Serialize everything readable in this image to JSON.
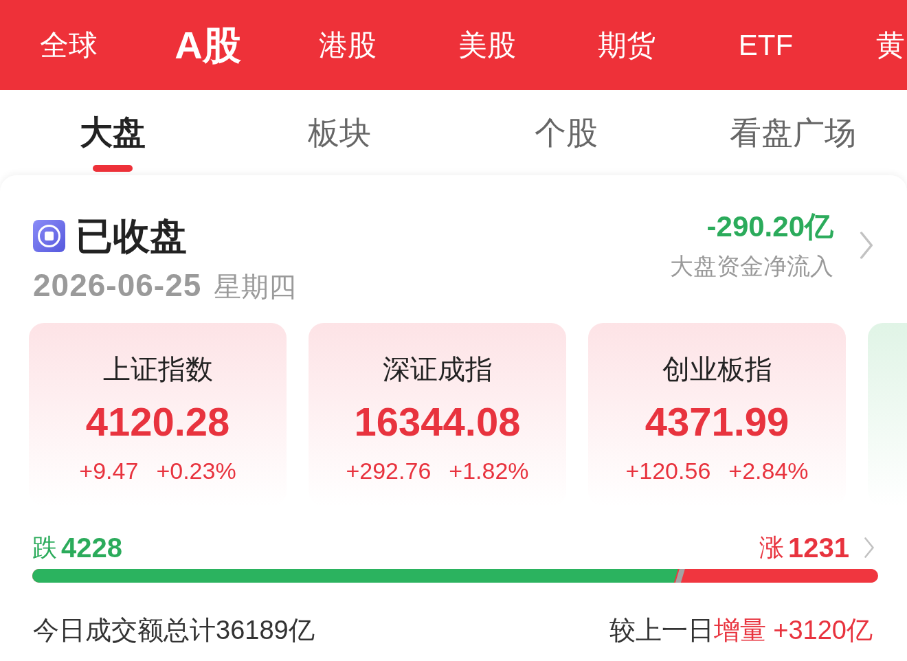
{
  "market_tabs": [
    {
      "label": "全球",
      "selected": false
    },
    {
      "label": "A股",
      "selected": true
    },
    {
      "label": "港股",
      "selected": false
    },
    {
      "label": "美股",
      "selected": false
    },
    {
      "label": "期货",
      "selected": false
    },
    {
      "label": "ETF",
      "selected": false
    },
    {
      "label": "黄",
      "selected": false
    }
  ],
  "section_tabs": [
    {
      "label": "大盘",
      "selected": true
    },
    {
      "label": "板块",
      "selected": false
    },
    {
      "label": "个股",
      "selected": false
    },
    {
      "label": "看盘广场",
      "selected": false
    }
  ],
  "market_status": {
    "status": "已收盘",
    "date": "2026-06-25",
    "weekday": "星期四"
  },
  "net_inflow": {
    "value": "-290.20亿",
    "label": "大盘资金净流入"
  },
  "index_cards": [
    {
      "kind": "rise",
      "name": "上证指数",
      "value": "4120.28",
      "change": "+9.47",
      "change_percent": "+0.23%"
    },
    {
      "kind": "rise",
      "name": "深证成指",
      "value": "16344.08",
      "change": "+292.76",
      "change_percent": "+1.82%"
    },
    {
      "kind": "rise",
      "name": "创业板指",
      "value": "4371.99",
      "change": "+120.56",
      "change_percent": "+2.84%"
    },
    {
      "kind": "fall"
    }
  ],
  "breadth": {
    "fall_label": "跌",
    "fall_count": "4228",
    "rise_label": "涨",
    "rise_count": "1231",
    "level": 0.77
  },
  "turnover": {
    "text": "今日成交额总计36189亿",
    "compare_label": "较上一日",
    "change_label": "增量",
    "change": "+3120亿"
  }
}
